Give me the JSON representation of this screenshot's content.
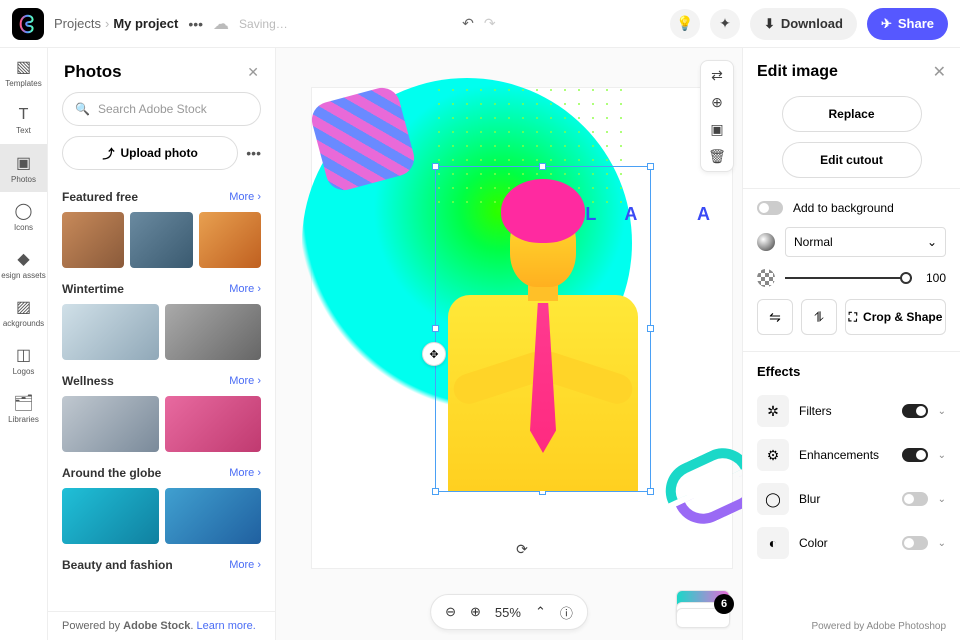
{
  "breadcrumb": {
    "root": "Projects",
    "current": "My project"
  },
  "saving_label": "Saving…",
  "download_label": "Download",
  "share_label": "Share",
  "rail": [
    {
      "key": "templates",
      "label": "Templates",
      "icon": "▧"
    },
    {
      "key": "text",
      "label": "Text",
      "icon": "T"
    },
    {
      "key": "photos",
      "label": "Photos",
      "icon": "▣"
    },
    {
      "key": "icons",
      "label": "Icons",
      "icon": "◯"
    },
    {
      "key": "assets",
      "label": "esign assets",
      "icon": "◆"
    },
    {
      "key": "bg",
      "label": "ackgrounds",
      "icon": "▨"
    },
    {
      "key": "logos",
      "label": "Logos",
      "icon": "◫"
    },
    {
      "key": "libraries",
      "label": "Libraries",
      "icon": "🗂"
    }
  ],
  "rail_active": "photos",
  "photos_panel": {
    "title": "Photos",
    "search_placeholder": "Search Adobe Stock",
    "upload_label": "Upload photo",
    "more_label": "More",
    "sections": [
      {
        "name": "Featured free"
      },
      {
        "name": "Wintertime"
      },
      {
        "name": "Wellness"
      },
      {
        "name": "Around the globe"
      },
      {
        "name": "Beauty and fashion"
      }
    ],
    "footer": {
      "prefix": "Powered by ",
      "brand": "Adobe Stock",
      "link": "Learn more."
    }
  },
  "canvas": {
    "overlay_text": "LA   A",
    "zoom": {
      "value": "55%"
    },
    "page_badge": "6"
  },
  "right_panel": {
    "title": "Edit image",
    "replace_label": "Replace",
    "cutout_label": "Edit cutout",
    "add_bg_label": "Add to background",
    "add_bg_on": false,
    "blend_mode": "Normal",
    "opacity_value": "100",
    "crop_label": "Crop & Shape",
    "effects_title": "Effects",
    "effects": [
      {
        "name": "Filters",
        "icon": "✲",
        "on": true
      },
      {
        "name": "Enhancements",
        "icon": "⚙",
        "on": true
      },
      {
        "name": "Blur",
        "icon": "◯",
        "on": false
      },
      {
        "name": "Color",
        "icon": "◐",
        "on": false
      }
    ],
    "powered_by": "Powered by Adobe Photoshop"
  }
}
